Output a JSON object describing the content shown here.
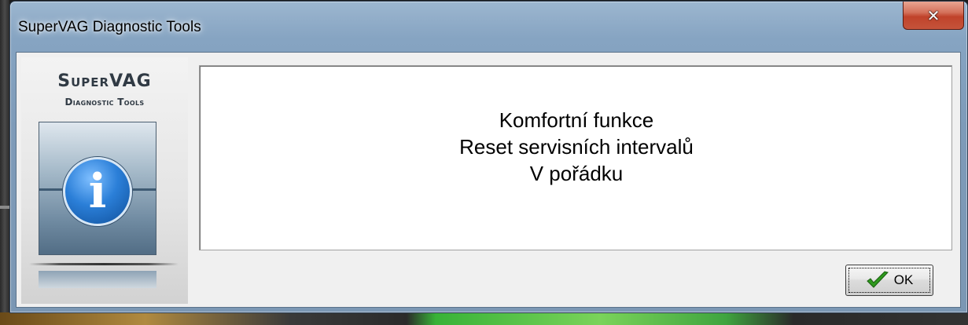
{
  "window": {
    "title": "SuperVAG Diagnostic Tools",
    "close_icon": "close-icon"
  },
  "logo": {
    "line1": "SuperVAG",
    "line2": "Diagnostic Tools",
    "icon": "info-icon",
    "icon_glyph": "i"
  },
  "message": {
    "lines": [
      "Komfortní funkce",
      "Reset servisních intervalů",
      "V pořádku"
    ]
  },
  "buttons": {
    "ok_label": "OK",
    "ok_icon": "checkmark-icon"
  },
  "colors": {
    "accent_green": "#2f9a1e",
    "close_red": "#c0432b",
    "info_blue": "#2b7fd8"
  }
}
